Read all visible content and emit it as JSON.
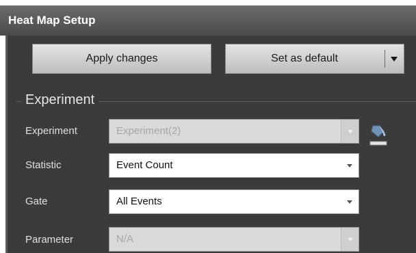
{
  "window": {
    "title": "Heat Map Setup"
  },
  "toolbar": {
    "apply_label": "Apply changes",
    "default_label": "Set as default"
  },
  "experiment_group": {
    "title": "Experiment",
    "rows": [
      {
        "label": "Experiment",
        "value": "Experiment(2)",
        "enabled": false
      },
      {
        "label": "Statistic",
        "value": "Event Count",
        "enabled": true
      },
      {
        "label": "Gate",
        "value": "All Events",
        "enabled": true
      },
      {
        "label": "Parameter",
        "value": "N/A",
        "enabled": false
      }
    ]
  },
  "colors": {
    "panel_bg": "#3b3b3b",
    "titlebar_bg": "#555555",
    "text_light": "#e0e0e0",
    "icon_accent": "#6f94b8"
  },
  "icons": {
    "dropdown": "chevron-down-icon",
    "fill_color": "paint-bucket-icon"
  }
}
